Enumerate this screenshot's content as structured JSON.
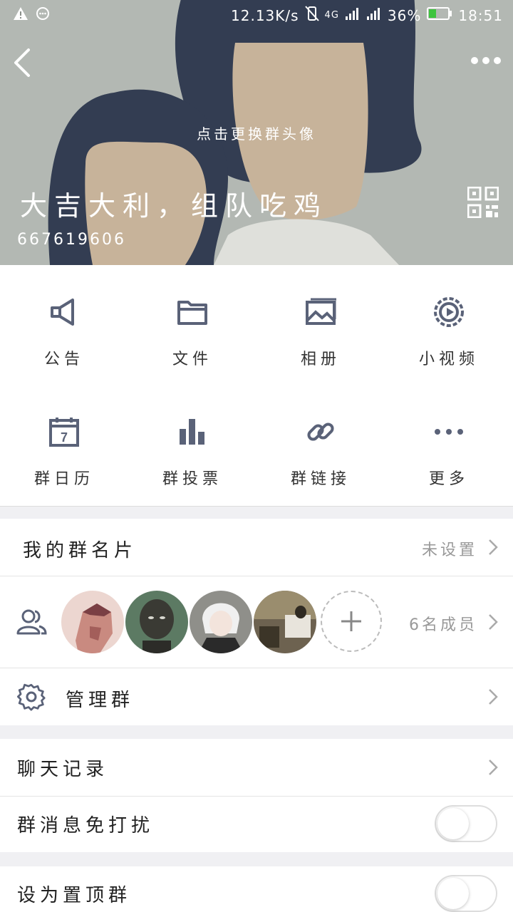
{
  "status_bar": {
    "speed": "12.13K/s",
    "network": "4G",
    "battery": "36%",
    "time": "18:51"
  },
  "header": {
    "change_avatar_hint": "点击更换群头像",
    "group_name": "大吉大利，组队吃鸡",
    "group_id": "667619606"
  },
  "features": [
    {
      "label": "公告",
      "icon": "megaphone-icon"
    },
    {
      "label": "文件",
      "icon": "folder-icon"
    },
    {
      "label": "相册",
      "icon": "album-icon"
    },
    {
      "label": "小视频",
      "icon": "video-icon"
    },
    {
      "label": "群日历",
      "icon": "calendar-icon",
      "calendar_day": "7"
    },
    {
      "label": "群投票",
      "icon": "vote-icon"
    },
    {
      "label": "群链接",
      "icon": "link-icon"
    },
    {
      "label": "更多",
      "icon": "more-icon"
    }
  ],
  "card": {
    "label": "我的群名片",
    "value": "未设置"
  },
  "members": {
    "count_label": "6名成员"
  },
  "manage": {
    "label": "管理群"
  },
  "chat_history": {
    "label": "聊天记录"
  },
  "mute": {
    "label": "群消息免打扰",
    "enabled": false
  },
  "pin": {
    "label": "设为置顶群",
    "enabled": false
  },
  "colors": {
    "accent": "#5a6278",
    "header_bg": "#b3b8b3",
    "hair": "#333d52",
    "skin": "#c7b39a"
  }
}
